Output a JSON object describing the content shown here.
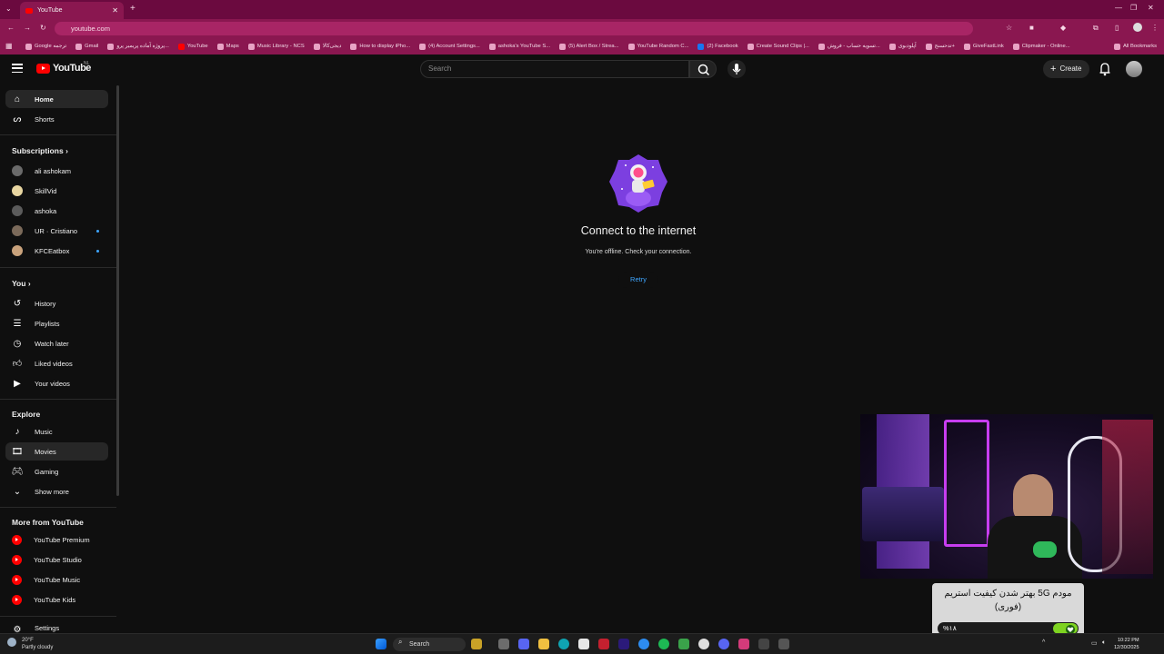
{
  "browser": {
    "tab_title": "YouTube",
    "url": "youtube.com",
    "bookmarks": [
      "Google ترجمه",
      "Gmail",
      "پروژه آماده پریمیر پرو...",
      "YouTube",
      "Maps",
      "Music Library - NCS",
      "دیجی‌کالا",
      "How to display iPho...",
      "(4) Account Settings...",
      "ashoka's YouTube S...",
      "(5) Alert Box / Strea...",
      "YouTube Random C...",
      "(2) Facebook",
      "Create Sound Clips |...",
      "تسویه حساب - فروش...",
      "آپلودبوی",
      "تدحسنج+",
      "GiveFastLink",
      "Clipmaker - Online..."
    ],
    "all_bookmarks": "All Bookmarks"
  },
  "header": {
    "logo_text": "YouTube",
    "region": "NL",
    "search_placeholder": "Search",
    "create_label": "Create"
  },
  "sidebar": {
    "main": [
      {
        "label": "Home",
        "icon": "home-icon",
        "active": true
      },
      {
        "label": "Shorts",
        "icon": "shorts-icon",
        "active": false
      }
    ],
    "subscriptions_heading": "Subscriptions",
    "subscriptions": [
      {
        "label": "ali ashokam",
        "live": false,
        "color": "#6a6a6a"
      },
      {
        "label": "SkillVid",
        "live": false,
        "color": "#e8d6a1"
      },
      {
        "label": "ashoka",
        "live": false,
        "color": "#5b5b5b"
      },
      {
        "label": "UR · Cristiano",
        "live": true,
        "color": "#7b6a5a"
      },
      {
        "label": "KFCEatbox",
        "live": true,
        "color": "#c9a27c"
      }
    ],
    "you_heading": "You",
    "you": [
      {
        "label": "History",
        "icon": "history-icon"
      },
      {
        "label": "Playlists",
        "icon": "playlists-icon"
      },
      {
        "label": "Watch later",
        "icon": "watch-later-icon"
      },
      {
        "label": "Liked videos",
        "icon": "liked-videos-icon"
      },
      {
        "label": "Your videos",
        "icon": "your-videos-icon"
      }
    ],
    "explore_heading": "Explore",
    "explore": [
      {
        "label": "Music",
        "icon": "music-icon"
      },
      {
        "label": "Movies",
        "icon": "movies-icon"
      },
      {
        "label": "Gaming",
        "icon": "gaming-icon"
      },
      {
        "label": "Show more",
        "icon": "chevron-down-icon"
      }
    ],
    "more_heading": "More from YouTube",
    "more": [
      {
        "label": "YouTube Premium"
      },
      {
        "label": "YouTube Studio"
      },
      {
        "label": "YouTube Music"
      },
      {
        "label": "YouTube Kids"
      }
    ],
    "settings_label": "Settings"
  },
  "main": {
    "offline_title": "Connect to the internet",
    "offline_message": "You're offline. Check your connection.",
    "retry_label": "Retry"
  },
  "overlay": {
    "banner_text": "مودم 5G بهتر شدن کیفیت استریم (فوری)",
    "progress_label": "%۱۸"
  },
  "taskbar": {
    "weather_temp": "20°F",
    "weather_desc": "Partly cloudy",
    "search_label": "Search",
    "time": "10:22 PM",
    "date": "12/30/2025"
  },
  "colors": {
    "browser_frame": "#8a1750",
    "youtube_red": "#ff0000",
    "link_blue": "#3ea6ff",
    "progress_green": "#7ed321"
  }
}
